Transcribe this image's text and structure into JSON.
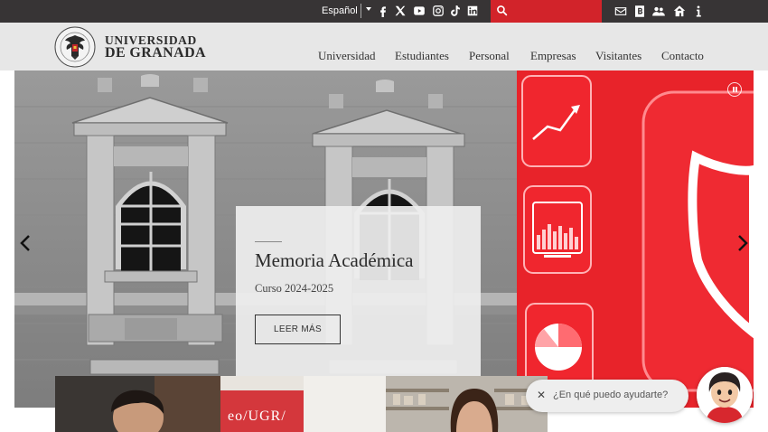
{
  "topbar": {
    "language": "Español",
    "social_icons": [
      "facebook-icon",
      "x-icon",
      "youtube-icon",
      "instagram-icon",
      "tiktok-icon",
      "linkedin-icon"
    ],
    "search": {
      "placeholder": ""
    },
    "utility_icons": [
      "mail-icon",
      "directory-icon",
      "people-icon",
      "home-access-icon",
      "info-icon"
    ],
    "colors": {
      "bar": "#373435",
      "search": "#d2232a"
    }
  },
  "header": {
    "brand_line1": "UNIVERSIDAD",
    "brand_line2": "DE GRANADA",
    "nav": [
      "Universidad",
      "Estudiantes",
      "Personal",
      "Empresas",
      "Visitantes",
      "Contacto"
    ]
  },
  "hero": {
    "title": "Memoria Académica",
    "subtitle": "Curso 2024-2025",
    "button": "LEER MÁS",
    "accent": "#e4171f"
  },
  "thumbs": {
    "sign_text": "eo/UGR/"
  },
  "chat": {
    "prompt": "¿En qué puedo ayudarte?"
  }
}
